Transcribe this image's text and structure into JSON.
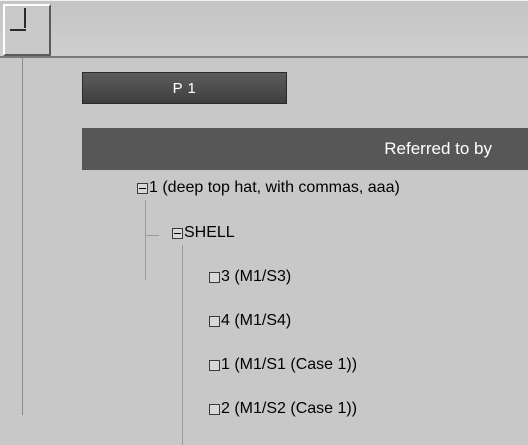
{
  "tab": {
    "label": "P 1"
  },
  "panel": {
    "header": "Referred to by"
  },
  "tree": {
    "root": {
      "label": "1 (deep top hat, with commas, aaa)",
      "expanded": true
    },
    "group": {
      "label": "SHELL",
      "expanded": true
    },
    "items": [
      {
        "label": "3 (M1/S3)"
      },
      {
        "label": "4 (M1/S4)"
      },
      {
        "label": "1 (M1/S1 (Case 1))"
      },
      {
        "label": "2 (M1/S2 (Case 1))"
      }
    ]
  }
}
